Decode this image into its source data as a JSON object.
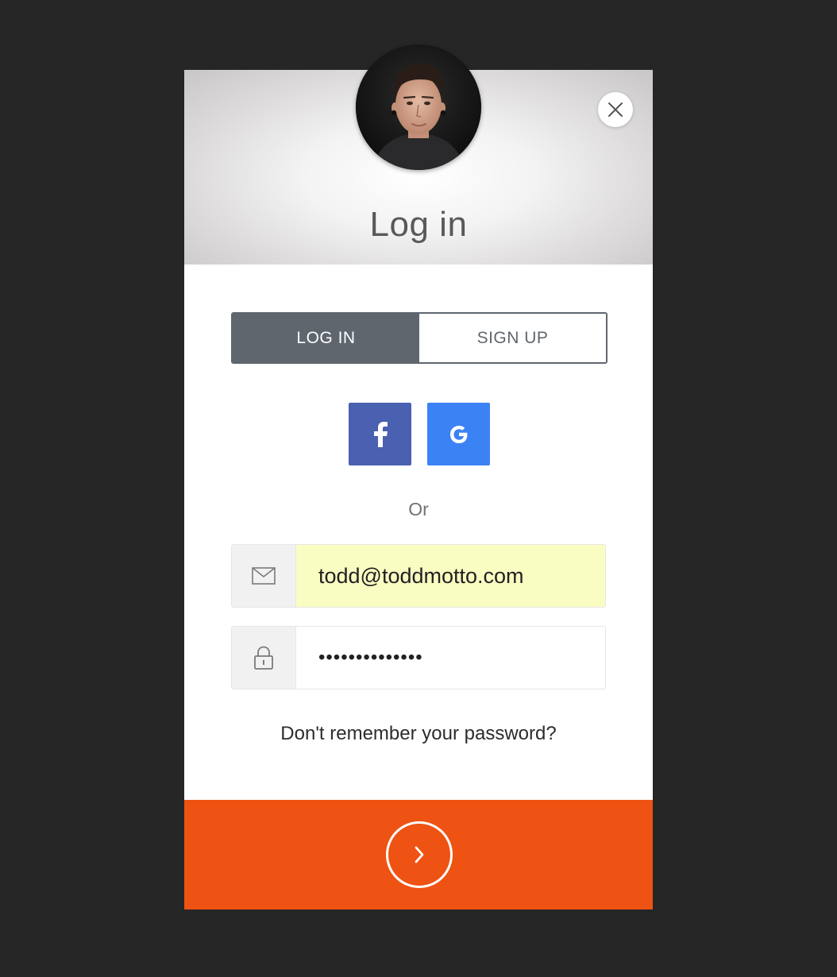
{
  "header": {
    "title": "Log in"
  },
  "tabs": {
    "login_label": "LOG IN",
    "signup_label": "SIGN UP",
    "active": "login"
  },
  "social": {
    "facebook_glyph": "f",
    "google_glyph": "G",
    "facebook_color": "#4a60b0",
    "google_color": "#3b82f4"
  },
  "divider_text": "Or",
  "email": {
    "value": "todd@toddmotto.com",
    "icon": "envelope-icon"
  },
  "password": {
    "value": "••••••••••••••",
    "icon": "lock-icon"
  },
  "forgot_link": "Don't remember your password?",
  "submit": {
    "icon": "chevron-right-icon",
    "color": "#ee5313"
  },
  "close": {
    "icon": "close-icon"
  },
  "colors": {
    "background": "#262626",
    "tab_active": "#5f666e",
    "autofill": "#f9fdc1"
  }
}
